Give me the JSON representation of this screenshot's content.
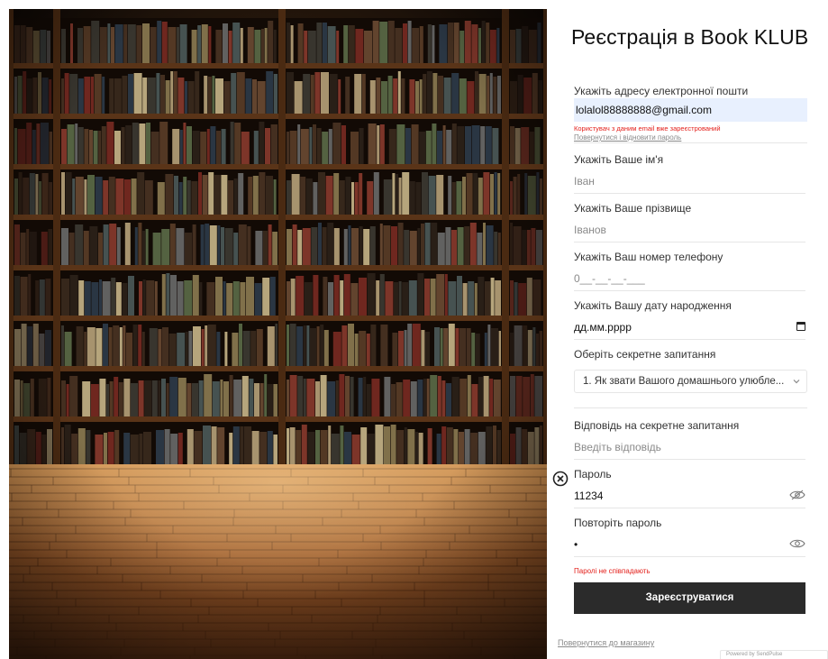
{
  "form": {
    "title": "Реєстрація в Book KLUB",
    "email": {
      "label": "Укажіть адресу електронної пошти",
      "value": "lolalol88888888@gmail.com",
      "error": "Користувач з даним email вже зареєстрований",
      "restore_link": "Повернутися і відновити пароль"
    },
    "first_name": {
      "label": "Укажіть Ваше ім'я",
      "placeholder": "Іван"
    },
    "last_name": {
      "label": "Укажіть Ваше прізвище",
      "placeholder": "Іванов"
    },
    "phone": {
      "label": "Укажіть Ваш номер телефону",
      "placeholder": "0__-__-__-___"
    },
    "birthdate": {
      "label": "Укажіть Вашу дату народження",
      "value": "дд.мм.рррр"
    },
    "secret_question": {
      "label": "Оберіть секретне запитання",
      "selected": "1. Як звати Вашого домашнього улюбле..."
    },
    "secret_answer": {
      "label": "Відповідь на секретне запитання",
      "placeholder": "Введіть відповідь"
    },
    "password": {
      "label": "Пароль",
      "value": "11234"
    },
    "repeat_password": {
      "label": "Повторіть пароль",
      "value": "•",
      "error": "Паролі не співпадають"
    },
    "submit_label": "Зареєструватися"
  },
  "back_to_store_link": "Повернутися до магазину",
  "badge_text": "Powered by SendPulse",
  "colors": {
    "error": "#e3201b",
    "button": "#2b2b2b",
    "autofill": "#e8f0fe",
    "wood_shelf": "#5a3418",
    "floor": "#9b5a2a"
  },
  "icons": {
    "calendar": "calendar-icon",
    "chevron": "chevron-down-icon",
    "clear": "clear-circle-icon",
    "eye_hidden": "eye-slash-icon",
    "eye": "eye-icon"
  }
}
